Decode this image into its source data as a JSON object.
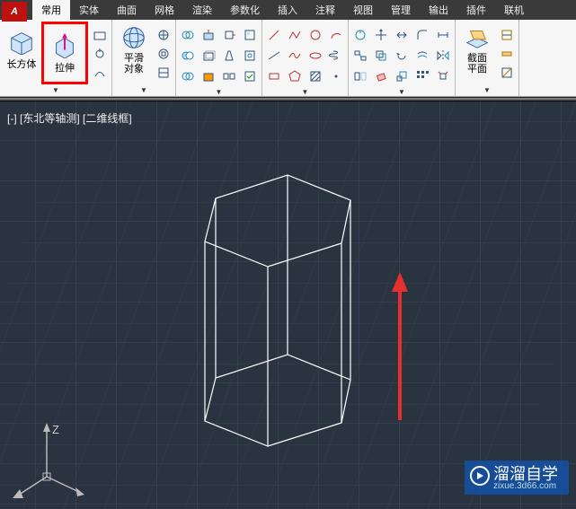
{
  "app_icon_letter": "A",
  "tabs": [
    "常用",
    "实体",
    "曲面",
    "网格",
    "渲染",
    "参数化",
    "插入",
    "注释",
    "视图",
    "管理",
    "输出",
    "插件",
    "联机"
  ],
  "active_tab_index": 0,
  "panel_box": {
    "label": "长方体",
    "icon": "box"
  },
  "panel_extrude": {
    "label": "拉伸",
    "icon": "extrude"
  },
  "panel_smooth": {
    "big_label": "平滑\n对象",
    "label": "",
    "icon": "mesh-sphere"
  },
  "panel_section": {
    "big_label": "截面\n平面",
    "label": "",
    "icon": "section"
  },
  "viewport": {
    "label": "[-] [东北等轴测] [二维线框]",
    "ucs_label": "Z"
  },
  "watermark": {
    "title": "溜溜自学",
    "sub": "zixue.3d66.com"
  }
}
